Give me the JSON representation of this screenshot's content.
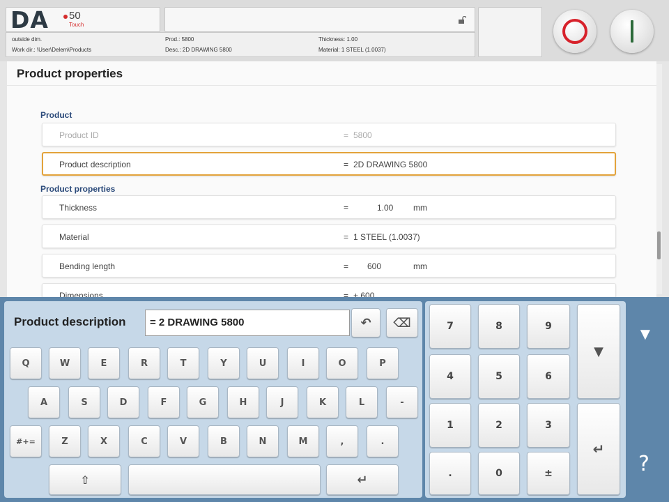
{
  "header": {
    "logo": "DA",
    "logo_model": "50",
    "logo_touch": "Touch",
    "info": {
      "outside_dim": "outside dim.",
      "work_dir": "Work dir.: \\User\\Delem\\Products",
      "prod": "Prod.: 5800",
      "desc": "Desc.: 2D DRAWING 5800",
      "thickness": "Thickness: 1.00",
      "material": "Material: 1 STEEL (1.0037)"
    }
  },
  "panel": {
    "title": "Product properties",
    "section_product": "Product",
    "section_properties": "Product properties",
    "rows": [
      {
        "label": "Product ID",
        "eq": "=",
        "value": "5800",
        "unit": ""
      },
      {
        "label": "Product description",
        "eq": "=",
        "value": "2D DRAWING 5800",
        "unit": ""
      },
      {
        "label": "Thickness",
        "eq": "=",
        "value": "1.00",
        "unit": "mm"
      },
      {
        "label": "Material",
        "eq": "=",
        "value": "1 STEEL (1.0037)",
        "unit": ""
      },
      {
        "label": "Bending length",
        "eq": "=",
        "value": "600",
        "unit": "mm"
      },
      {
        "label": "Dimensions",
        "eq": "=",
        "value": "+ 600",
        "unit": ""
      }
    ]
  },
  "keyboard": {
    "field_label": "Product description",
    "field_value": "= 2 DRAWING 5800",
    "row1": [
      "Q",
      "W",
      "E",
      "R",
      "T",
      "Y",
      "U",
      "I",
      "O",
      "P"
    ],
    "row2": [
      "A",
      "S",
      "D",
      "F",
      "G",
      "H",
      "J",
      "K",
      "L",
      "-"
    ],
    "row3": [
      "#+=",
      "Z",
      "X",
      "C",
      "V",
      "B",
      "N",
      "M",
      ",",
      "."
    ],
    "undo_icon": "↶",
    "backspace_icon": "⌫",
    "shift_icon": "⇧",
    "enter_icon": "↵",
    "numpad": [
      "7",
      "8",
      "9",
      "4",
      "5",
      "6",
      "1",
      "2",
      "3",
      ".",
      "0",
      "±"
    ],
    "nav_down_icon": "▼",
    "nav_enter_icon": "↵",
    "side_arrow_icon": "▼",
    "side_help": "?"
  }
}
